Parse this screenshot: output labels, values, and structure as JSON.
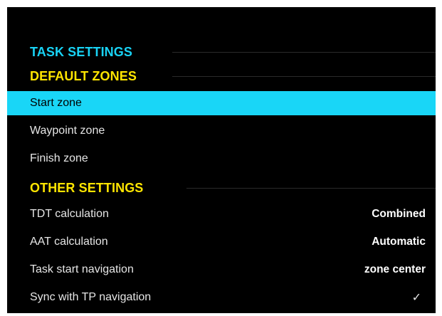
{
  "headers": {
    "task_settings": "TASK SETTINGS",
    "default_zones": "DEFAULT ZONES",
    "other_settings": "OTHER SETTINGS"
  },
  "default_zones": [
    {
      "label": "Start zone",
      "selected": true
    },
    {
      "label": "Waypoint zone",
      "selected": false
    },
    {
      "label": "Finish zone",
      "selected": false
    }
  ],
  "other_settings": [
    {
      "label": "TDT calculation",
      "value": "Combined"
    },
    {
      "label": "AAT calculation",
      "value": "Automatic"
    },
    {
      "label": "Task start navigation",
      "value": "zone center"
    },
    {
      "label": "Sync with TP navigation",
      "value": "✓"
    }
  ],
  "colors": {
    "background": "#000000",
    "accent_cyan": "#19d6f7",
    "accent_yellow": "#ffe500",
    "text": "#e6e6e6"
  },
  "icons": {
    "sync_checked": "check-icon"
  }
}
